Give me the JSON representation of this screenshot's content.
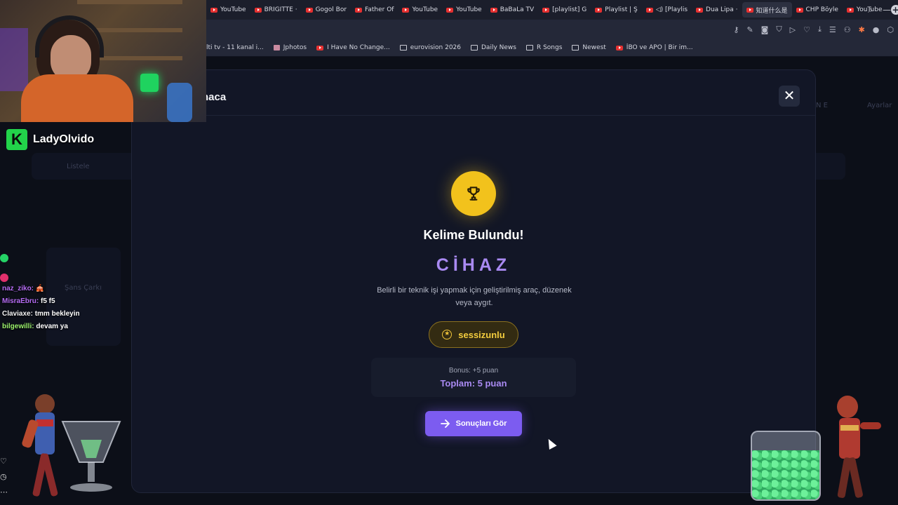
{
  "browser": {
    "tabs": [
      {
        "label": "YouTube",
        "icon": "youtube-icon"
      },
      {
        "label": "BRIGITTE ·",
        "icon": "youtube-icon"
      },
      {
        "label": "Gogol Bor",
        "icon": "youtube-icon"
      },
      {
        "label": "Father Of",
        "icon": "youtube-icon"
      },
      {
        "label": "YouTube",
        "icon": "youtube-icon"
      },
      {
        "label": "YouTube",
        "icon": "youtube-icon"
      },
      {
        "label": "BaBaLa TV",
        "icon": "youtube-icon"
      },
      {
        "label": "[playlist] G",
        "icon": "youtube-icon"
      },
      {
        "label": "Playlist | Ş",
        "icon": "youtube-icon"
      },
      {
        "label": "◁) [Playlis",
        "icon": "youtube-icon"
      },
      {
        "label": "Dua Lipa ·",
        "icon": "youtube-icon"
      },
      {
        "label": "知道什么是",
        "icon": "youtube-icon"
      },
      {
        "label": "CHP Böyle",
        "icon": "youtube-icon"
      },
      {
        "label": "YouTube",
        "icon": "youtube-icon"
      }
    ],
    "bookmarks": [
      {
        "label": "lti tv - 11 kanal i...",
        "icon": "none"
      },
      {
        "label": "Jphotos",
        "icon": "image-icon"
      },
      {
        "label": "I Have No Change...",
        "icon": "youtube-icon"
      },
      {
        "label": "eurovision 2026",
        "icon": "folder-icon"
      },
      {
        "label": "Daily News",
        "icon": "folder-icon"
      },
      {
        "label": "R Songs",
        "icon": "folder-icon"
      },
      {
        "label": "Newest",
        "icon": "folder-icon"
      },
      {
        "label": "İBO ve APO | Bir im...",
        "icon": "youtube-icon"
      }
    ]
  },
  "background_page": {
    "header_right": "Ayarlar",
    "header_badge": "N E",
    "nav_item": "Listele",
    "panel_label": "Şans Çarkı"
  },
  "modal": {
    "title": "naca",
    "close_label": "✕",
    "heading": "Kelime Bulundu!",
    "word": "CİHAZ",
    "definition": "Belirli bir teknik işi yapmak için geliştirilmiş araç, düzenek veya aygıt.",
    "finder": "sessizunlu",
    "bonus": "Bonus: +5 puan",
    "total": "Toplam: 5 puan",
    "results_button": "Sonuçları Gör"
  },
  "stream": {
    "channel": "LadyOlvido",
    "platform_logo": "K",
    "chat": [
      {
        "user": "naz_ziko:",
        "message": "🎪",
        "user_color": "#b56cf3"
      },
      {
        "user": "MisraEbru:",
        "message": "f5 f5",
        "user_color": "#b56cf3"
      },
      {
        "user": "Claviaxe:",
        "message": "tmm bekleyin",
        "user_color": "#f3f3f3"
      },
      {
        "user": "bilgewilli:",
        "message": "devam ya",
        "user_color": "#9cf26c"
      }
    ]
  },
  "colors": {
    "accent_purple": "#7c5cf0",
    "word_purple": "#a98af2",
    "trophy_gold": "#f2c21c",
    "kick_green": "#22d34a"
  }
}
